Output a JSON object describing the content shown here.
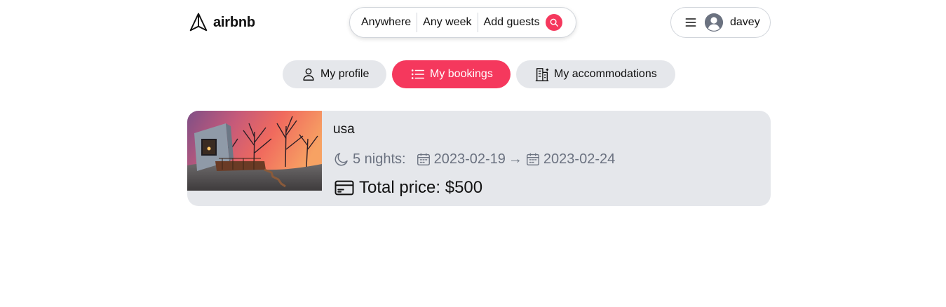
{
  "brand": {
    "name": "airbnb",
    "logo_icon": "paper-plane-icon",
    "accent": "#f5385d"
  },
  "search": {
    "where": "Anywhere",
    "when": "Any week",
    "guests": "Add guests",
    "icon": "search-icon"
  },
  "user": {
    "name": "davey",
    "menu_icon": "hamburger-icon",
    "avatar_icon": "user-circle-icon"
  },
  "tabs": [
    {
      "label": "My profile",
      "icon": "user-icon",
      "active": false
    },
    {
      "label": "My bookings",
      "icon": "list-icon",
      "active": true
    },
    {
      "label": "My accommodations",
      "icon": "building-icon",
      "active": false
    }
  ],
  "bookings": [
    {
      "title": "usa",
      "nights": "5 nights:",
      "check_in": "2023-02-19",
      "arrow": "→",
      "check_out": "2023-02-24",
      "price": "Total price: $500"
    }
  ]
}
